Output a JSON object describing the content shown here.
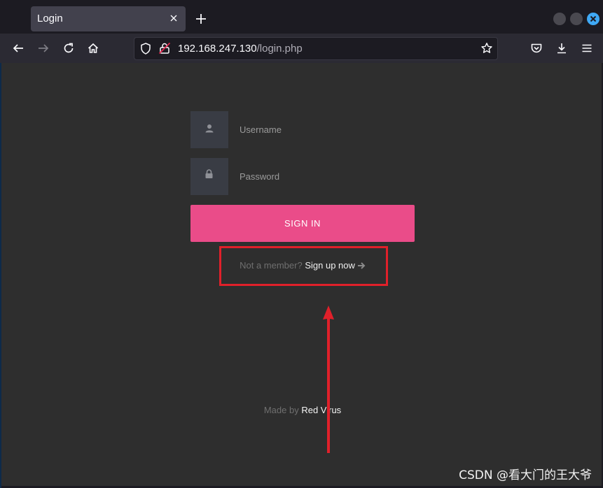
{
  "browser": {
    "tab_title": "Login",
    "url_host": "192.168.247.130",
    "url_path": "/login.php"
  },
  "login": {
    "username_placeholder": "Username",
    "password_placeholder": "Password",
    "signin_label": "SIGN IN",
    "signup_prompt": "Not a member?",
    "signup_link": "Sign up now",
    "footer_prefix": "Made by",
    "footer_author": "Red Virus"
  },
  "annotation": {
    "box_color": "#e0202a",
    "arrow_color": "#e0202a"
  },
  "watermark": "CSDN @看大门的王大爷",
  "colors": {
    "accent": "#ea4c89",
    "page_bg": "#2e2e2e",
    "chrome_bg": "#1c1b22"
  }
}
